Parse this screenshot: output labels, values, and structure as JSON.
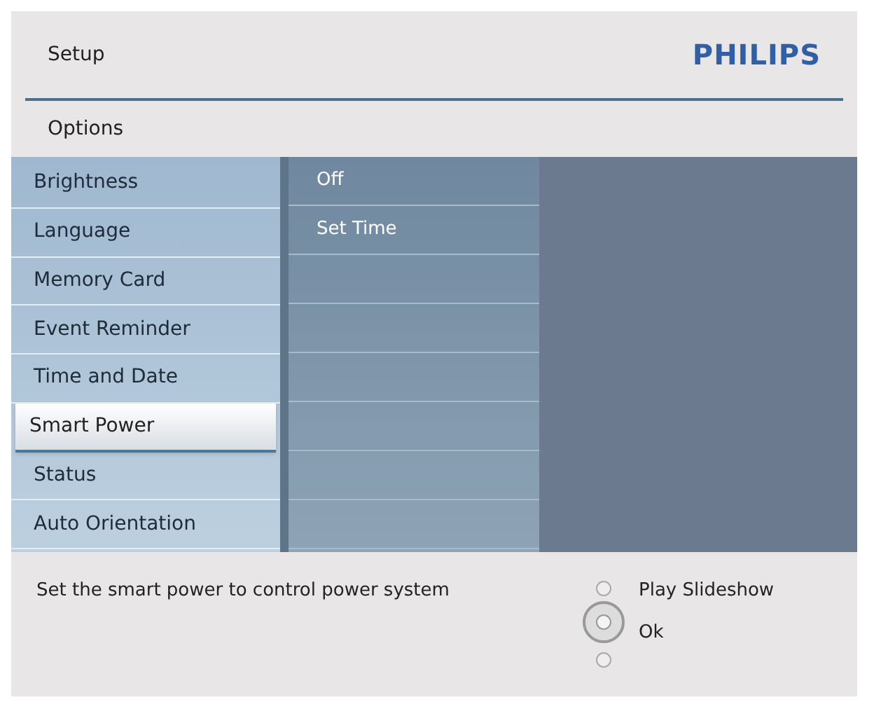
{
  "header": {
    "title": "Setup",
    "brand": "PHILIPS"
  },
  "section": {
    "title": "Options"
  },
  "menu": [
    {
      "label": "Brightness",
      "selected": false
    },
    {
      "label": "Language",
      "selected": false
    },
    {
      "label": "Memory Card",
      "selected": false
    },
    {
      "label": "Event Reminder",
      "selected": false
    },
    {
      "label": "Time and Date",
      "selected": false
    },
    {
      "label": "Smart Power",
      "selected": true
    },
    {
      "label": "Status",
      "selected": false
    },
    {
      "label": "Auto Orientation",
      "selected": false
    }
  ],
  "submenu": [
    {
      "label": "Off"
    },
    {
      "label": "Set Time"
    }
  ],
  "help": {
    "text": "Set the smart power to control power system"
  },
  "keys": [
    {
      "label": "Play Slideshow"
    },
    {
      "label": "Ok"
    }
  ]
}
